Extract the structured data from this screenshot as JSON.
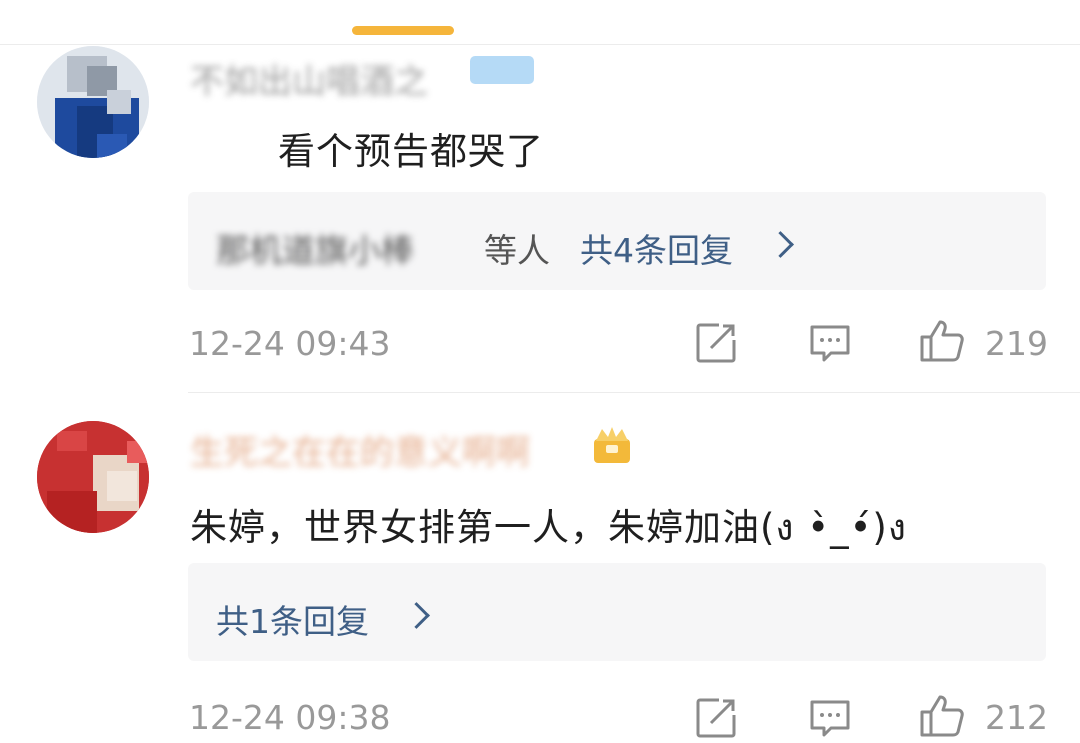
{
  "comments": [
    {
      "username": "不如出山唱酒之",
      "text": "看个预告都哭了",
      "reply_names": "那机道旗小棒",
      "reply_suffix": "等人",
      "reply_count": "共4条回复",
      "timestamp": "12-24 09:43",
      "likes": "219",
      "badge_color": "#a8d4f5"
    },
    {
      "username": "生死之在在的意义啊啊",
      "text": "朱婷，世界女排第一人，朱婷加油(ง •̀_•́)ง",
      "reply_names": "",
      "reply_suffix": "",
      "reply_count": "共1条回复",
      "timestamp": "12-24 09:38",
      "likes": "212",
      "badge_color": "#f3b93a"
    }
  ],
  "icons": {
    "share": "share-icon",
    "comment": "comment-icon",
    "like": "like-icon",
    "chevron": "chevron-right-icon"
  },
  "accent": "#f5b53b"
}
